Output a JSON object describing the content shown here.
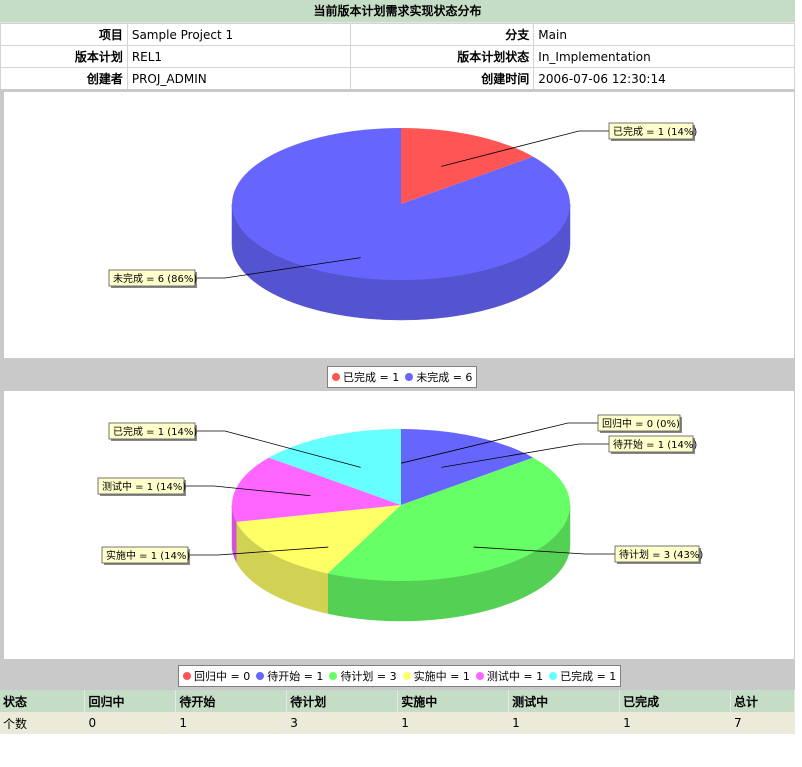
{
  "header": {
    "title": "当前版本计划需求实现状态分布"
  },
  "info": {
    "rows": [
      {
        "label1": "项目",
        "value1": "Sample Project 1",
        "label2": "分支",
        "value2": "Main"
      },
      {
        "label1": "版本计划",
        "value1": "REL1",
        "label2": "版本计划状态",
        "value2": "In_Implementation"
      },
      {
        "label1": "创建者",
        "value1": "PROJ_ADMIN",
        "label2": "创建时间",
        "value2": "2006-07-06 12:30:14"
      }
    ]
  },
  "chart_data": [
    {
      "type": "pie",
      "title": "",
      "slices": [
        {
          "name": "已完成",
          "value": 1,
          "percent": 14,
          "label": "已完成 = 1 (14%)",
          "color": "#ff5555"
        },
        {
          "name": "未完成",
          "value": 6,
          "percent": 86,
          "label": "未完成 = 6 (86%)",
          "color": "#6666ff"
        }
      ],
      "legend": [
        "已完成 = 1",
        "未完成 = 6"
      ],
      "legend_position": "bottom"
    },
    {
      "type": "pie",
      "title": "",
      "slices": [
        {
          "name": "回归中",
          "value": 0,
          "percent": 0,
          "label": "回归中 = 0 (0%)",
          "color": "#ff5555"
        },
        {
          "name": "待开始",
          "value": 1,
          "percent": 14,
          "label": "待开始 = 1 (14%)",
          "color": "#6666ff"
        },
        {
          "name": "待计划",
          "value": 3,
          "percent": 43,
          "label": "待计划 = 3 (43%)",
          "color": "#66ff66"
        },
        {
          "name": "实施中",
          "value": 1,
          "percent": 14,
          "label": "实施中 = 1 (14%)",
          "color": "#ffff66"
        },
        {
          "name": "测试中",
          "value": 1,
          "percent": 14,
          "label": "测试中 = 1 (14%)",
          "color": "#ff66ff"
        },
        {
          "name": "已完成",
          "value": 1,
          "percent": 14,
          "label": "已完成 = 1 (14%)",
          "color": "#66ffff"
        }
      ],
      "legend": [
        "回归中 = 0",
        "待开始 = 1",
        "待计划 = 3",
        "实施中 = 1",
        "测试中 = 1",
        "已完成 = 1"
      ],
      "legend_position": "bottom"
    }
  ],
  "stats": {
    "headers": [
      "状态",
      "回归中",
      "待开始",
      "待计划",
      "实施中",
      "测试中",
      "已完成",
      "总计"
    ],
    "row": [
      "个数",
      "0",
      "1",
      "3",
      "1",
      "1",
      "1",
      "7"
    ]
  }
}
